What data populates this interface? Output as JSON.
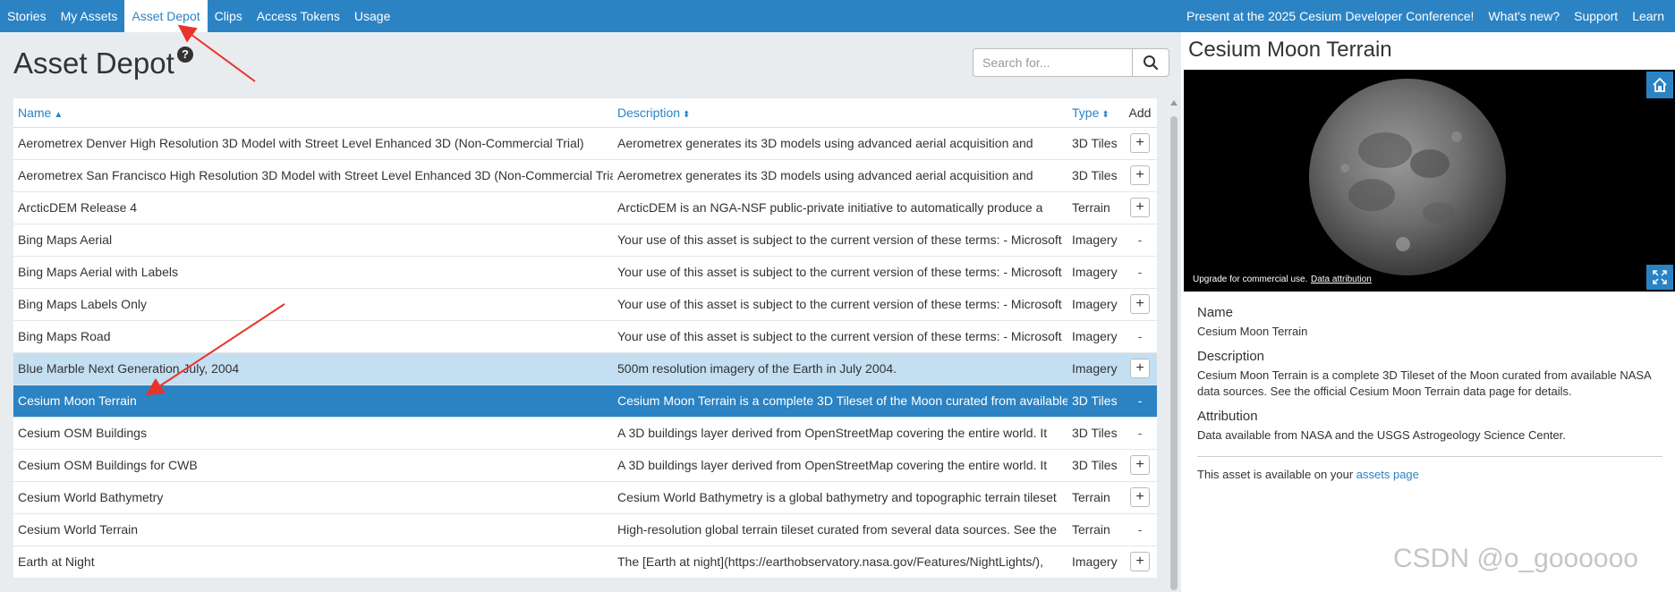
{
  "nav": {
    "left_items": [
      {
        "label": "Stories"
      },
      {
        "label": "My Assets"
      },
      {
        "label": "Asset Depot",
        "active": true
      },
      {
        "label": "Clips"
      },
      {
        "label": "Access Tokens"
      },
      {
        "label": "Usage"
      }
    ],
    "right_items": [
      {
        "label": "Present at the 2025 Cesium Developer Conference!"
      },
      {
        "label": "What's new?"
      },
      {
        "label": "Support"
      },
      {
        "label": "Learn"
      }
    ]
  },
  "page": {
    "title": "Asset Depot",
    "help_icon": "?",
    "search_placeholder": "Search for..."
  },
  "table": {
    "columns": {
      "name": "Name",
      "description": "Description",
      "type": "Type",
      "add": "Add"
    },
    "rows": [
      {
        "name": "Aerometrex Denver High Resolution 3D Model with Street Level Enhanced 3D (Non-Commercial Trial)",
        "description": "Aerometrex generates its 3D models using advanced aerial acquisition and",
        "type": "3D Tiles",
        "add": "+"
      },
      {
        "name": "Aerometrex San Francisco High Resolution 3D Model with Street Level Enhanced 3D (Non-Commercial Trial)",
        "description": "Aerometrex generates its 3D models using advanced aerial acquisition and",
        "type": "3D Tiles",
        "add": "+"
      },
      {
        "name": "ArcticDEM Release 4",
        "description": "ArcticDEM is an NGA-NSF public-private initiative to automatically produce a",
        "type": "Terrain",
        "add": "+"
      },
      {
        "name": "Bing Maps Aerial",
        "description": "Your use of this asset is subject to the current version of these terms: - Microsoft",
        "type": "Imagery",
        "add": "-"
      },
      {
        "name": "Bing Maps Aerial with Labels",
        "description": "Your use of this asset is subject to the current version of these terms: - Microsoft",
        "type": "Imagery",
        "add": "-"
      },
      {
        "name": "Bing Maps Labels Only",
        "description": "Your use of this asset is subject to the current version of these terms: - Microsoft",
        "type": "Imagery",
        "add": "+"
      },
      {
        "name": "Bing Maps Road",
        "description": "Your use of this asset is subject to the current version of these terms: - Microsoft",
        "type": "Imagery",
        "add": "-"
      },
      {
        "name": "Blue Marble Next Generation July, 2004",
        "description": "500m resolution imagery of the Earth in July 2004.",
        "type": "Imagery",
        "add": "+",
        "state": "hover"
      },
      {
        "name": "Cesium Moon Terrain",
        "description": "Cesium Moon Terrain is a complete 3D Tileset of the Moon curated from available",
        "type": "3D Tiles",
        "add": "-",
        "state": "selected"
      },
      {
        "name": "Cesium OSM Buildings",
        "description": "A 3D buildings layer derived from OpenStreetMap covering the entire world. It",
        "type": "3D Tiles",
        "add": "-"
      },
      {
        "name": "Cesium OSM Buildings for CWB",
        "description": "A 3D buildings layer derived from OpenStreetMap covering the entire world. It",
        "type": "3D Tiles",
        "add": "+"
      },
      {
        "name": "Cesium World Bathymetry",
        "description": "Cesium World Bathymetry is a global bathymetry and topographic terrain tileset",
        "type": "Terrain",
        "add": "+"
      },
      {
        "name": "Cesium World Terrain",
        "description": "High-resolution global terrain tileset curated from several data sources. See the",
        "type": "Terrain",
        "add": "-"
      },
      {
        "name": "Earth at Night",
        "description": "The [Earth at night](https://earthobservatory.nasa.gov/Features/NightLights/),",
        "type": "Imagery",
        "add": "+"
      }
    ]
  },
  "preview": {
    "title": "Cesium Moon Terrain",
    "credit": "Upgrade for commercial use.",
    "attribution_link": "Data attribution",
    "labels": {
      "name": "Name",
      "description": "Description",
      "attribution": "Attribution"
    },
    "name": "Cesium Moon Terrain",
    "description": "Cesium Moon Terrain is a complete 3D Tileset of the Moon curated from available NASA data sources. See the official Cesium Moon Terrain data page for details.",
    "attribution": "Data available from NASA and the USGS Astrogeology Science Center.",
    "availability_prefix": "This asset is available on your",
    "availability_link": "assets page"
  },
  "watermark": "CSDN @o_goooooo",
  "colors": {
    "nav": "#2b83c4",
    "selected_row": "#2b83c4",
    "hover_row": "#c4dff1",
    "annotation": "#e8342a"
  }
}
